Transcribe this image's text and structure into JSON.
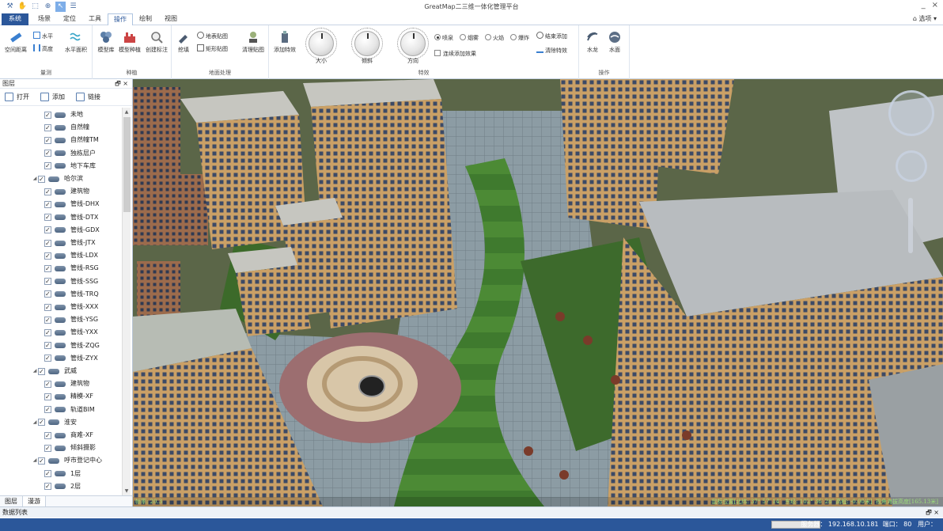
{
  "titlebar": {
    "title": "GreatMap二三维一体化管理平台",
    "minimize": "_",
    "close": "×"
  },
  "menu": {
    "tabs": [
      "系统",
      "场景",
      "定位",
      "工具",
      "操作",
      "绘制",
      "视图"
    ],
    "selected": "操作",
    "options": "选项"
  },
  "ribbon": {
    "measure": {
      "title": "量测",
      "space_distance": "空间距离",
      "horizontal": "水平",
      "height": "高度",
      "horizontal_area": "水平面积"
    },
    "species": {
      "title": "种植",
      "model_library": "模型库",
      "model_plant": "模型种植",
      "create_label": "创建标注"
    },
    "terrain": {
      "title": "地面处理",
      "excavate": "挖填",
      "terrain_stamp": "地表贴图",
      "rect_stamp": "矩形贴图",
      "clear_stamp": "清理贴图"
    },
    "effects": {
      "title": "特效",
      "add_effect": "添加特效",
      "size": "大小",
      "tilt": "倾斜",
      "direction": "方向",
      "radios": [
        "喷泉",
        "烟雾",
        "火焰",
        "爆炸"
      ],
      "radio_selected": 0,
      "continuous_add": "连续添加效果",
      "end_add": "结束添加",
      "clear_effect": "清除特效"
    },
    "operate": {
      "title": "操作",
      "water_dragon": "水龙",
      "water_surface": "水面"
    }
  },
  "layers": {
    "title": "图层",
    "open": "打开",
    "add": "添加",
    "link": "链接",
    "nodes": [
      {
        "label": "未地",
        "level": 2
      },
      {
        "label": "自然幢",
        "level": 2
      },
      {
        "label": "自然幢TM",
        "level": 2
      },
      {
        "label": "独栋层户",
        "level": 2
      },
      {
        "label": "地下车库",
        "level": 2
      },
      {
        "label": "哈尔滨",
        "level": 1
      },
      {
        "label": "建筑物",
        "level": 2
      },
      {
        "label": "管线-DHX",
        "level": 2
      },
      {
        "label": "管线-DTX",
        "level": 2
      },
      {
        "label": "管线-GDX",
        "level": 2
      },
      {
        "label": "管线-JTX",
        "level": 2
      },
      {
        "label": "管线-LDX",
        "level": 2
      },
      {
        "label": "管线-RSG",
        "level": 2
      },
      {
        "label": "管线-SSG",
        "level": 2
      },
      {
        "label": "管线-TRQ",
        "level": 2
      },
      {
        "label": "管线-XXX",
        "level": 2
      },
      {
        "label": "管线-YSG",
        "level": 2
      },
      {
        "label": "管线-YXX",
        "level": 2
      },
      {
        "label": "管线-ZQG",
        "level": 2
      },
      {
        "label": "管线-ZYX",
        "level": 2
      },
      {
        "label": "武威",
        "level": 1
      },
      {
        "label": "建筑物",
        "level": 2
      },
      {
        "label": "精模-XF",
        "level": 2
      },
      {
        "label": "轨道BIM",
        "level": 2
      },
      {
        "label": "淮安",
        "level": 1
      },
      {
        "label": "商难-XF",
        "level": 2
      },
      {
        "label": "倾斜摄影",
        "level": 2
      },
      {
        "label": "呼市登记中心",
        "level": 1
      },
      {
        "label": "1层",
        "level": 2
      },
      {
        "label": "2层",
        "level": 2
      }
    ],
    "bottom_tabs": [
      "图层",
      "漫游"
    ],
    "bottom_selected": "漫游"
  },
  "viewport": {
    "frame_rate": "帧率: 20.3",
    "coords": "鼠标位置[北纬: 37° 57′ 14″  东经: 102° 36′ 28″ 高程: -0.00米]  视角海拔高度[165.13米]"
  },
  "datalist": {
    "title": "数据列表"
  },
  "status": {
    "server_label": "服务器：",
    "server": "192.168.10.181",
    "port_label": "端口：",
    "port": "80",
    "user_label": "用户："
  },
  "colors": {
    "accent": "#2b579a",
    "coords_text": "#9ee07a"
  }
}
